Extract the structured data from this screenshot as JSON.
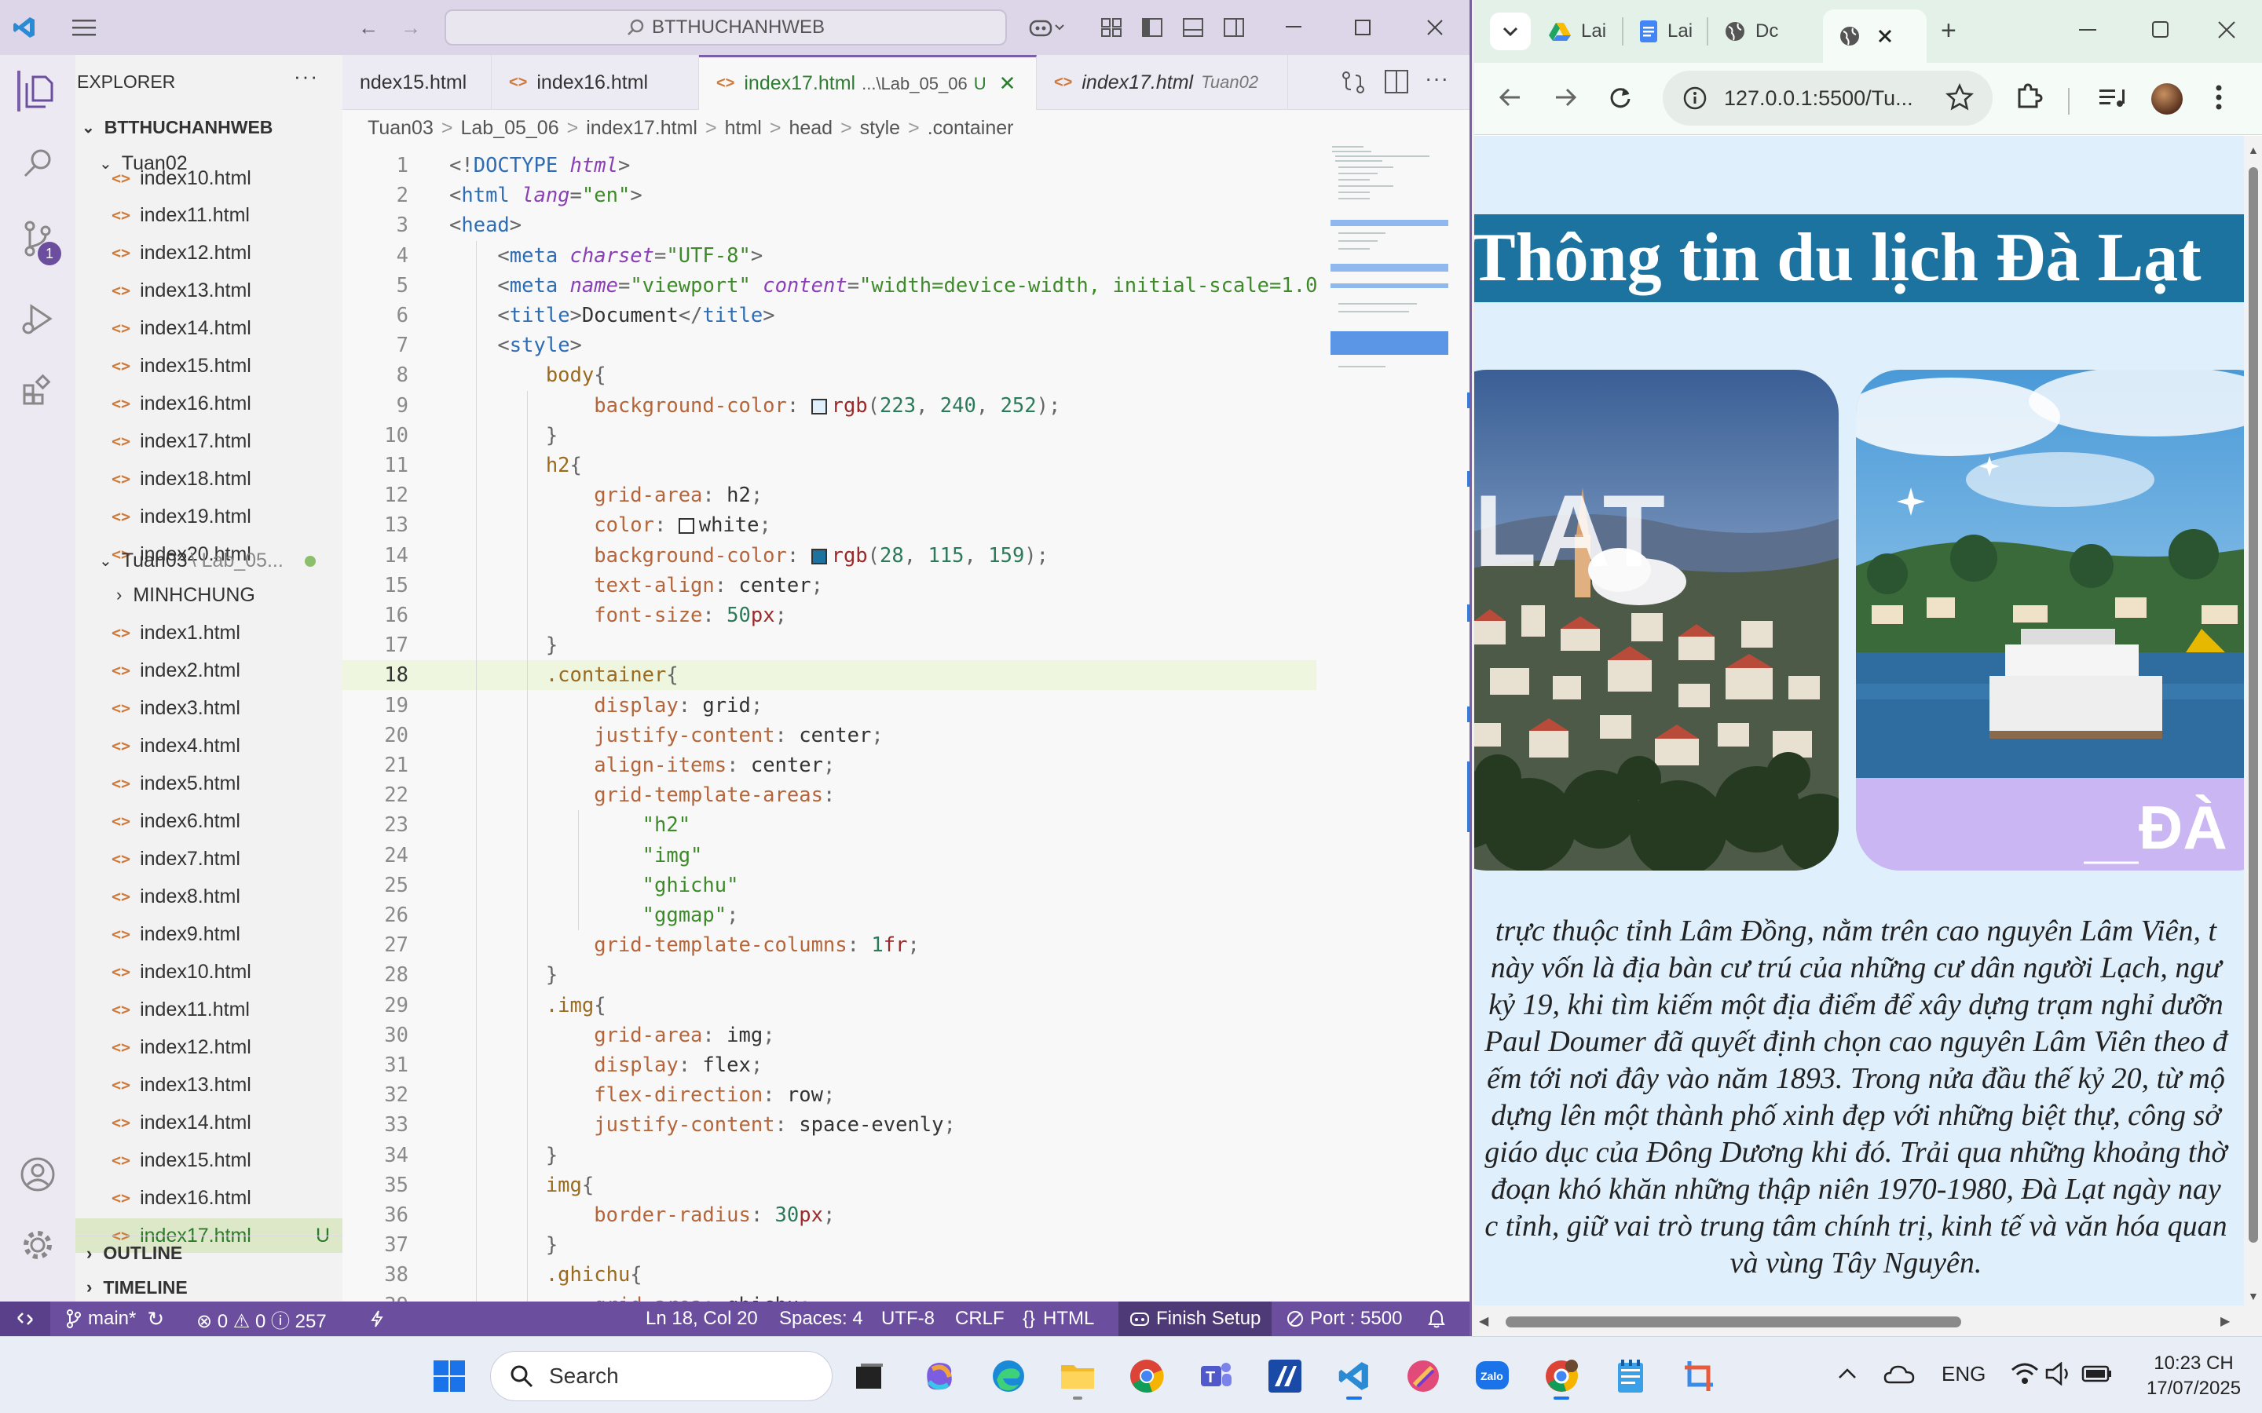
{
  "vscode": {
    "search_text": "BTTHUCHANHWEB",
    "explorer_title": "EXPLORER",
    "root_folder": "BTTHUCHANHWEB",
    "folder1": "Tuan02",
    "folder2": "Tuan03",
    "folder2_path": "\\ Lab_05...",
    "subfolder": "MINHCHUNG",
    "tuan02_files": [
      "index10.html",
      "index11.html",
      "index12.html",
      "index13.html",
      "index14.html",
      "index15.html",
      "index16.html",
      "index17.html",
      "index18.html",
      "index19.html",
      "index20.html"
    ],
    "tuan03_files": [
      "index1.html",
      "index2.html",
      "index3.html",
      "index4.html",
      "index5.html",
      "index6.html",
      "index7.html",
      "index8.html",
      "index9.html",
      "index10.html",
      "index11.html",
      "index12.html",
      "index13.html",
      "index14.html",
      "index15.html",
      "index16.html",
      "index17.html"
    ],
    "selected_badge": "U",
    "outline": "OUTLINE",
    "timeline": "TIMELINE",
    "tabs": [
      {
        "label": "ndex15.html",
        "path": ""
      },
      {
        "label": "index16.html",
        "path": ""
      },
      {
        "label": "index17.html",
        "path": "...\\Lab_05_06",
        "badge": "U"
      },
      {
        "label": "index17.html",
        "path": "Tuan02"
      }
    ],
    "breadcrumb": [
      "Tuan03",
      ">",
      "Lab_05_06",
      ">",
      "index17.html",
      ">",
      "html",
      ">",
      "head",
      ">",
      "style",
      ">",
      ".container"
    ],
    "scm_badge": "1",
    "status": {
      "branch": "main*",
      "problems": "⊗ 0 ⚠ 0 ⓘ 257",
      "position": "Ln 18, Col 20",
      "spaces": "Spaces: 4",
      "encoding": "UTF-8",
      "eol": "CRLF",
      "language": "HTML",
      "finish_setup": "Finish Setup",
      "port": "Port : 5500"
    }
  },
  "code_lines": [
    [
      [
        "pu",
        "<!"
      ],
      [
        "k",
        "DOCTYPE "
      ],
      [
        "at",
        "html"
      ],
      [
        "pu",
        ">"
      ]
    ],
    [
      [
        "pu",
        "<"
      ],
      [
        "tg",
        "html "
      ],
      [
        "at",
        "lang"
      ],
      [
        "pu",
        "="
      ],
      [
        "st",
        "\"en\""
      ],
      [
        "pu",
        ">"
      ]
    ],
    [
      [
        "pu",
        "<"
      ],
      [
        "tg",
        "head"
      ],
      [
        "pu",
        ">"
      ]
    ],
    [
      [
        "t",
        "    "
      ],
      [
        "pu",
        "<"
      ],
      [
        "tg",
        "meta "
      ],
      [
        "at",
        "charset"
      ],
      [
        "pu",
        "="
      ],
      [
        "st",
        "\"UTF-8\""
      ],
      [
        "pu",
        ">"
      ]
    ],
    [
      [
        "t",
        "    "
      ],
      [
        "pu",
        "<"
      ],
      [
        "tg",
        "meta "
      ],
      [
        "at",
        "name"
      ],
      [
        "pu",
        "="
      ],
      [
        "st",
        "\"viewport\" "
      ],
      [
        "at",
        "content"
      ],
      [
        "pu",
        "="
      ],
      [
        "st",
        "\"width=device-width, initial-scale=1.0\""
      ]
    ],
    [
      [
        "t",
        "    "
      ],
      [
        "pu",
        "<"
      ],
      [
        "tg",
        "title"
      ],
      [
        "pu",
        ">"
      ],
      [
        "t",
        "Document"
      ],
      [
        "pu",
        "</"
      ],
      [
        "tg",
        "title"
      ],
      [
        "pu",
        ">"
      ]
    ],
    [
      [
        "t",
        "    "
      ],
      [
        "pu",
        "<"
      ],
      [
        "tg",
        "style"
      ],
      [
        "pu",
        ">"
      ]
    ],
    [
      [
        "t",
        "        "
      ],
      [
        "sel2",
        "body"
      ],
      [
        "pu",
        "{"
      ]
    ],
    [
      [
        "t",
        "            "
      ],
      [
        "pr",
        "background-color"
      ],
      [
        "pu",
        ": "
      ],
      [
        "sw",
        "#dff0fc"
      ],
      [
        "fn",
        "rgb"
      ],
      [
        "pu",
        "("
      ],
      [
        "nm",
        "223"
      ],
      [
        "pu",
        ", "
      ],
      [
        "nm",
        "240"
      ],
      [
        "pu",
        ", "
      ],
      [
        "nm",
        "252"
      ],
      [
        "pu",
        ");"
      ]
    ],
    [
      [
        "t",
        "        "
      ],
      [
        "pu",
        "}"
      ]
    ],
    [
      [
        "t",
        "        "
      ],
      [
        "sel2",
        "h2"
      ],
      [
        "pu",
        "{"
      ]
    ],
    [
      [
        "t",
        "            "
      ],
      [
        "pr",
        "grid-area"
      ],
      [
        "pu",
        ": "
      ],
      [
        "t",
        "h2"
      ],
      [
        "pu",
        ";"
      ]
    ],
    [
      [
        "t",
        "            "
      ],
      [
        "pr",
        "color"
      ],
      [
        "pu",
        ": "
      ],
      [
        "sw",
        "#ffffff"
      ],
      [
        "t",
        "white"
      ],
      [
        "pu",
        ";"
      ]
    ],
    [
      [
        "t",
        "            "
      ],
      [
        "pr",
        "background-color"
      ],
      [
        "pu",
        ": "
      ],
      [
        "sw",
        "#1c739f"
      ],
      [
        "fn",
        "rgb"
      ],
      [
        "pu",
        "("
      ],
      [
        "nm",
        "28"
      ],
      [
        "pu",
        ", "
      ],
      [
        "nm",
        "115"
      ],
      [
        "pu",
        ", "
      ],
      [
        "nm",
        "159"
      ],
      [
        "pu",
        ");"
      ]
    ],
    [
      [
        "t",
        "            "
      ],
      [
        "pr",
        "text-align"
      ],
      [
        "pu",
        ": "
      ],
      [
        "t",
        "center"
      ],
      [
        "pu",
        ";"
      ]
    ],
    [
      [
        "t",
        "            "
      ],
      [
        "pr",
        "font-size"
      ],
      [
        "pu",
        ": "
      ],
      [
        "nm",
        "50"
      ],
      [
        "fn",
        "px"
      ],
      [
        "pu",
        ";"
      ]
    ],
    [
      [
        "t",
        "        "
      ],
      [
        "pu",
        "}"
      ]
    ],
    [
      [
        "t",
        "        "
      ],
      [
        "sel2",
        ".container"
      ],
      [
        "pu",
        "{"
      ]
    ],
    [
      [
        "t",
        "            "
      ],
      [
        "pr",
        "display"
      ],
      [
        "pu",
        ": "
      ],
      [
        "t",
        "grid"
      ],
      [
        "pu",
        ";"
      ]
    ],
    [
      [
        "t",
        "            "
      ],
      [
        "pr",
        "justify-content"
      ],
      [
        "pu",
        ": "
      ],
      [
        "t",
        "center"
      ],
      [
        "pu",
        ";"
      ]
    ],
    [
      [
        "t",
        "            "
      ],
      [
        "pr",
        "align-items"
      ],
      [
        "pu",
        ": "
      ],
      [
        "t",
        "center"
      ],
      [
        "pu",
        ";"
      ]
    ],
    [
      [
        "t",
        "            "
      ],
      [
        "pr",
        "grid-template-areas"
      ],
      [
        "pu",
        ":"
      ]
    ],
    [
      [
        "t",
        "                "
      ],
      [
        "st",
        "\"h2\""
      ]
    ],
    [
      [
        "t",
        "                "
      ],
      [
        "st",
        "\"img\""
      ]
    ],
    [
      [
        "t",
        "                "
      ],
      [
        "st",
        "\"ghichu\""
      ]
    ],
    [
      [
        "t",
        "                "
      ],
      [
        "st",
        "\"ggmap\""
      ],
      [
        "pu",
        ";"
      ]
    ],
    [
      [
        "t",
        "            "
      ],
      [
        "pr",
        "grid-template-columns"
      ],
      [
        "pu",
        ": "
      ],
      [
        "nm",
        "1"
      ],
      [
        "fn",
        "fr"
      ],
      [
        "pu",
        ";"
      ]
    ],
    [
      [
        "t",
        "        "
      ],
      [
        "pu",
        "}"
      ]
    ],
    [
      [
        "t",
        "        "
      ],
      [
        "sel2",
        ".img"
      ],
      [
        "pu",
        "{"
      ]
    ],
    [
      [
        "t",
        "            "
      ],
      [
        "pr",
        "grid-area"
      ],
      [
        "pu",
        ": "
      ],
      [
        "t",
        "img"
      ],
      [
        "pu",
        ";"
      ]
    ],
    [
      [
        "t",
        "            "
      ],
      [
        "pr",
        "display"
      ],
      [
        "pu",
        ": "
      ],
      [
        "t",
        "flex"
      ],
      [
        "pu",
        ";"
      ]
    ],
    [
      [
        "t",
        "            "
      ],
      [
        "pr",
        "flex-direction"
      ],
      [
        "pu",
        ": "
      ],
      [
        "t",
        "row"
      ],
      [
        "pu",
        ";"
      ]
    ],
    [
      [
        "t",
        "            "
      ],
      [
        "pr",
        "justify-content"
      ],
      [
        "pu",
        ": "
      ],
      [
        "t",
        "space-evenly"
      ],
      [
        "pu",
        ";"
      ]
    ],
    [
      [
        "t",
        "        "
      ],
      [
        "pu",
        "}"
      ]
    ],
    [
      [
        "t",
        "        "
      ],
      [
        "sel2",
        "img"
      ],
      [
        "pu",
        "{"
      ]
    ],
    [
      [
        "t",
        "            "
      ],
      [
        "pr",
        "border-radius"
      ],
      [
        "pu",
        ": "
      ],
      [
        "nm",
        "30"
      ],
      [
        "fn",
        "px"
      ],
      [
        "pu",
        ";"
      ]
    ],
    [
      [
        "t",
        "        "
      ],
      [
        "pu",
        "}"
      ]
    ],
    [
      [
        "t",
        "        "
      ],
      [
        "sel2",
        ".ghichu"
      ],
      [
        "pu",
        "{"
      ]
    ],
    [
      [
        "t",
        "            "
      ],
      [
        "pr",
        "grid-area"
      ],
      [
        "pu",
        ": "
      ],
      [
        "t",
        "ghichu"
      ],
      [
        "pu",
        ";"
      ]
    ]
  ],
  "chrome": {
    "tabs": [
      "Lai",
      "Lai",
      "Dc",
      ""
    ],
    "url": "127.0.0.1:5500/Tu...",
    "page_title": "Thông tin du lịch Đà Lạt",
    "image1_text": "LAT",
    "image2_text": "ĐÀ",
    "paragraph": [
      "trực thuộc tỉnh Lâm Đồng, nằm trên cao nguyên Lâm Viên, t",
      "này vốn là địa bàn cư trú của những cư dân người Lạch, ngư",
      "kỷ 19, khi tìm kiếm một địa điểm để xây dựng trạm nghỉ dưỡn",
      "Paul Doumer đã quyết định chọn cao nguyên Lâm Viên theo đ",
      "ếm tới nơi đây vào năm 1893. Trong nửa đầu thế kỷ 20, từ mộ",
      "dựng lên một thành phố xinh đẹp với những biệt thự, công sở",
      "giáo dục của Đông Dương khi đó. Trải qua những khoảng thờ",
      "đoạn khó khăn những thập niên 1970-1980, Đà Lạt ngày nay",
      "c tỉnh, giữ vai trò trung tâm chính trị, kinh tế và văn hóa quan",
      "và vùng Tây Nguyên."
    ]
  },
  "taskbar": {
    "search": "Search",
    "lang": "ENG",
    "time": "10:23 CH",
    "date": "17/07/2025"
  }
}
